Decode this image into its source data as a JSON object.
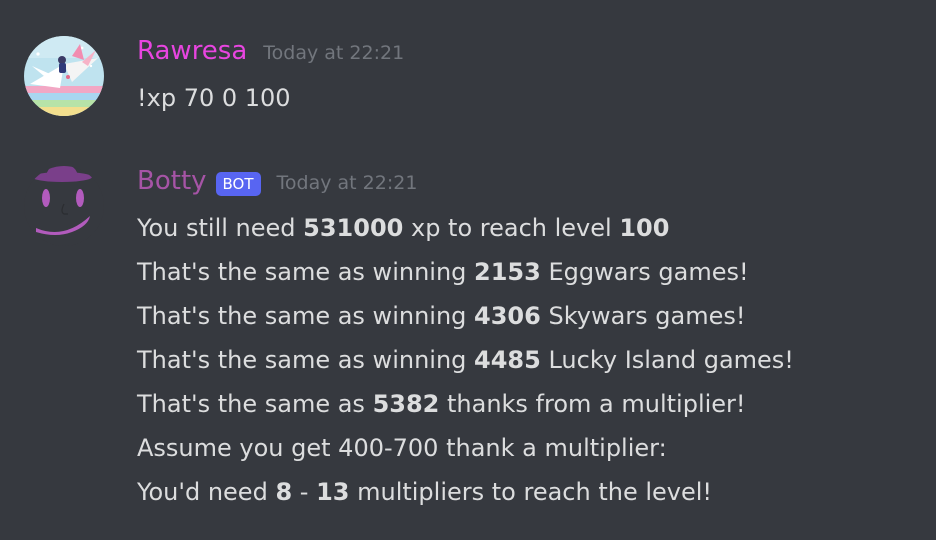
{
  "colors": {
    "background": "#36393f",
    "rawresa_name": "#e845e0",
    "botty_name": "#a654a6",
    "bot_tag": "#5865f2",
    "timestamp": "#72767d",
    "text": "#dcddde"
  },
  "messages": [
    {
      "author": "Rawresa",
      "timestamp": "Today at 22:21",
      "avatar_icon": "paper-crane-avatar-icon",
      "text": "!xp 70 0 100"
    },
    {
      "author": "Botty",
      "bot_tag": "BOT",
      "timestamp": "Today at 22:21",
      "avatar_icon": "hat-face-avatar-icon",
      "lines": [
        {
          "pre": "You still need ",
          "b1": "531000",
          "mid": " xp to reach level ",
          "b2": "100",
          "post": ""
        },
        {
          "pre": "That's the same as winning ",
          "b1": "2153",
          "mid": " Eggwars games!",
          "b2": "",
          "post": ""
        },
        {
          "pre": "That's the same as winning ",
          "b1": "4306",
          "mid": " Skywars games!",
          "b2": "",
          "post": ""
        },
        {
          "pre": "That's the same as winning ",
          "b1": "4485",
          "mid": " Lucky Island games!",
          "b2": "",
          "post": ""
        },
        {
          "pre": "That's the same as ",
          "b1": "5382",
          "mid": " thanks from a multiplier!",
          "b2": "",
          "post": ""
        },
        {
          "pre": "Assume you get 400-700 thank a multiplier:",
          "b1": "",
          "mid": "",
          "b2": "",
          "post": ""
        },
        {
          "pre": "You'd need ",
          "b1": "8",
          "mid": " - ",
          "b2": "13",
          "post": " multipliers to reach the level!"
        }
      ]
    }
  ]
}
